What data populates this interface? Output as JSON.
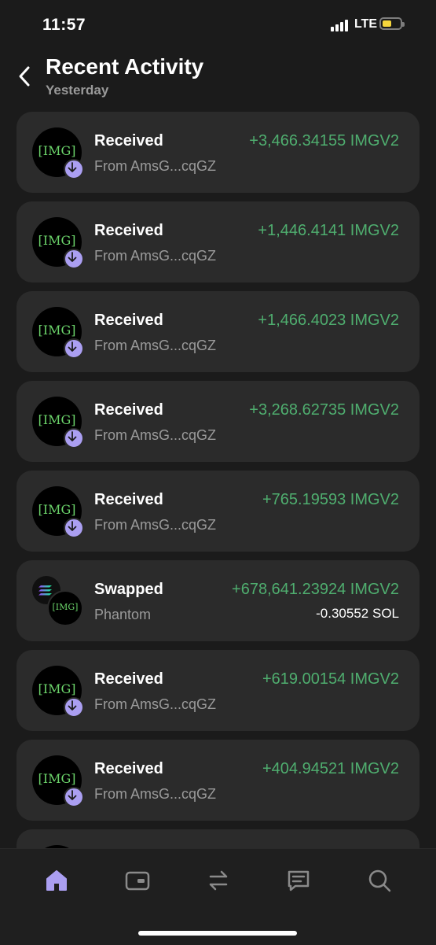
{
  "status_bar": {
    "time": "11:57",
    "network": "LTE"
  },
  "header": {
    "title": "Recent Activity",
    "subtitle": "Yesterday"
  },
  "activities": [
    {
      "type": "Received",
      "detail": "From AmsG...cqGZ",
      "amount": "+3,466.34155 IMGV2",
      "icon": "[IMG]"
    },
    {
      "type": "Received",
      "detail": "From AmsG...cqGZ",
      "amount": "+1,446.4141 IMGV2",
      "icon": "[IMG]"
    },
    {
      "type": "Received",
      "detail": "From AmsG...cqGZ",
      "amount": "+1,466.4023 IMGV2",
      "icon": "[IMG]"
    },
    {
      "type": "Received",
      "detail": "From AmsG...cqGZ",
      "amount": "+3,268.62735 IMGV2",
      "icon": "[IMG]"
    },
    {
      "type": "Received",
      "detail": "From AmsG...cqGZ",
      "amount": "+765.19593 IMGV2",
      "icon": "[IMG]"
    },
    {
      "type": "Swapped",
      "detail": "Phantom",
      "amount": "+678,641.23924 IMGV2",
      "amount_secondary": "-0.30552 SOL",
      "icon": "[IMG]"
    },
    {
      "type": "Received",
      "detail": "From AmsG...cqGZ",
      "amount": "+619.00154 IMGV2",
      "icon": "[IMG]"
    },
    {
      "type": "Received",
      "detail": "From AmsG...cqGZ",
      "amount": "+404.94521 IMGV2",
      "icon": "[IMG]"
    }
  ],
  "nav": {
    "items": [
      {
        "name": "home",
        "icon": "home-icon",
        "active": true
      },
      {
        "name": "collectibles",
        "icon": "wallet-card-icon",
        "active": false
      },
      {
        "name": "swap",
        "icon": "swap-arrows-icon",
        "active": false
      },
      {
        "name": "messages",
        "icon": "chat-icon",
        "active": false
      },
      {
        "name": "search",
        "icon": "search-icon",
        "active": false
      }
    ]
  },
  "colors": {
    "accent": "#ab9ff2",
    "positive": "#4fae6f",
    "card": "#2b2b2b",
    "background": "#1b1b1b"
  }
}
